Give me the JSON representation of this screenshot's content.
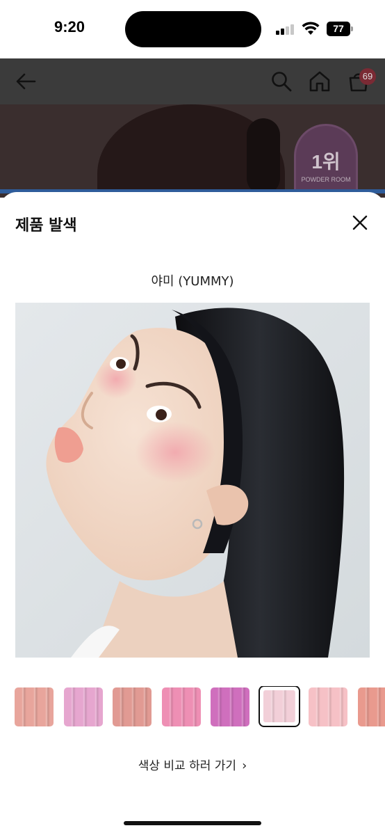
{
  "status_bar": {
    "time": "9:20",
    "battery": "77"
  },
  "app_header": {
    "icons": [
      "back-arrow-icon",
      "search-icon",
      "home-icon",
      "cart-icon"
    ],
    "cart_count": "69"
  },
  "hero": {
    "badge_rank": "1위",
    "badge_sub": "POWDER ROOM"
  },
  "sheet": {
    "title": "제품 발색",
    "close_icon": "close-icon",
    "shade_name": "야미 (YUMMY)",
    "swatches": [
      {
        "color": "#e8a59c",
        "selected": false
      },
      {
        "color": "#e6a6cf",
        "selected": false
      },
      {
        "color": "#e19a93",
        "selected": false
      },
      {
        "color": "#ee8fb4",
        "selected": false
      },
      {
        "color": "#cf6fbd",
        "selected": false
      },
      {
        "color": "#f2cfd8",
        "selected": true
      },
      {
        "color": "#f6c1c6",
        "selected": false
      },
      {
        "color": "#e99a8e",
        "selected": false
      }
    ],
    "compare_link": "색상 비교 하러 가기"
  },
  "colors": {
    "sheet_bg": "#ffffff",
    "overlay": "#3b3b3b",
    "accent_line": "#2e5c9a"
  }
}
